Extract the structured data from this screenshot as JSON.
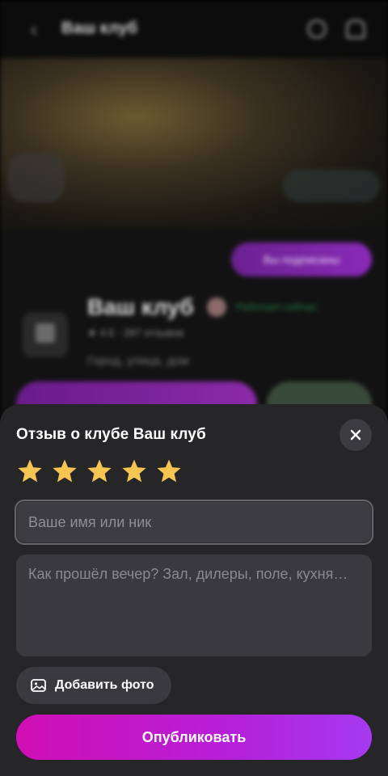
{
  "background": {
    "header_title": "Ваш клуб",
    "subscribe_label": "Вы подписаны",
    "club_name": "Ваш клуб",
    "status": "Работает сейчас",
    "rating": "★ 4.6 · 287 отзывов",
    "address": "Город, улица, дом"
  },
  "sheet": {
    "title": "Отзыв о клубе Ваш клуб",
    "rating": {
      "value": 5,
      "max": 5,
      "color": "#f5c451"
    },
    "name_field": {
      "value": "",
      "placeholder": "Ваше имя или ник"
    },
    "review_field": {
      "value": "",
      "placeholder": "Как прошёл вечер? Зал, дилеры, поле, кухня…"
    },
    "add_photo_label": "Добавить фото",
    "publish_label": "Опубликовать",
    "icons": {
      "close": "close-icon",
      "photo": "image-icon",
      "star": "star-icon"
    },
    "colors": {
      "sheet_bg": "#262528",
      "accent_start": "#d10fb4",
      "accent_end": "#a63af0"
    }
  }
}
